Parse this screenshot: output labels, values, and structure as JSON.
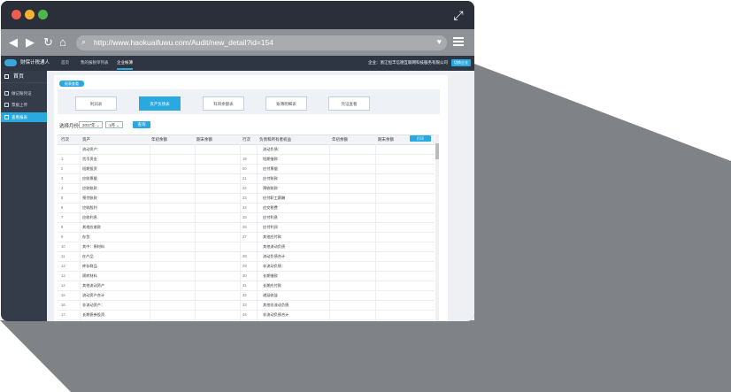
{
  "browser": {
    "url": "http://www.haokuaifuwu.com/Audit/new_detail?id=154"
  },
  "app": {
    "logo_text": "财保计税通人",
    "top_nav": [
      "首页",
      "我的报税单列表",
      "企业帐薄"
    ],
    "active_top_nav": "企业帐薄",
    "user_info": "企业：浙江恒丰信德互联网科技服务有限公司",
    "user_button": "切换企业"
  },
  "sidebar": {
    "home_label": "首页",
    "items": [
      {
        "label": "做记账凭证"
      },
      {
        "label": "票据上传"
      },
      {
        "label": "查看报表"
      }
    ],
    "active_index": 2
  },
  "content": {
    "tag": "报表查看",
    "tabs": [
      {
        "label": "利润表"
      },
      {
        "label": "资产负债表"
      },
      {
        "label": "科目余额表"
      },
      {
        "label": "账簿明细表"
      },
      {
        "label": "凭证查看"
      }
    ],
    "active_tab": 1,
    "filter_label": "选择月份",
    "year_value": "2017年",
    "month_value": "1月",
    "query_button": "查询",
    "print_button": "打印",
    "headers": [
      "行次",
      "资产",
      "年初余额",
      "期末余额",
      "行次",
      "负债和所有者权益",
      "年初余额",
      "期末余额"
    ],
    "rows": [
      {
        "n1": "",
        "left": "流动资产：",
        "n2": "",
        "right": "流动负债："
      },
      {
        "n1": "1",
        "left": "货币资金",
        "n2": "19",
        "right": "短期借款"
      },
      {
        "n1": "2",
        "left": "短期投资",
        "n2": "20",
        "right": "应付票据"
      },
      {
        "n1": "3",
        "left": "应收票据",
        "n2": "21",
        "right": "应付账款"
      },
      {
        "n1": "4",
        "left": "应收账款",
        "n2": "22",
        "right": "预收账款"
      },
      {
        "n1": "5",
        "left": "预付账款",
        "n2": "23",
        "right": "应付职工薪酬"
      },
      {
        "n1": "6",
        "left": "应收股利",
        "n2": "24",
        "right": "应交税费"
      },
      {
        "n1": "7",
        "left": "应收利息",
        "n2": "25",
        "right": "应付利息"
      },
      {
        "n1": "8",
        "left": "其他应收款",
        "n2": "26",
        "right": "应付利润"
      },
      {
        "n1": "9",
        "left": "存货",
        "n2": "27",
        "right": "其他应付款"
      },
      {
        "n1": "10",
        "left": "其中：原材料",
        "n2": "",
        "right": "其他流动负债"
      },
      {
        "n1": "11",
        "left": "在产品",
        "n2": "28",
        "right": "流动负债合计"
      },
      {
        "n1": "12",
        "left": "库存商品",
        "n2": "29",
        "right": "非流动负债："
      },
      {
        "n1": "13",
        "left": "周转材料",
        "n2": "30",
        "right": "长期借款"
      },
      {
        "n1": "14",
        "left": "其他流动资产",
        "n2": "31",
        "right": "长期应付款"
      },
      {
        "n1": "15",
        "left": "流动资产合计",
        "n2": "32",
        "right": "递延收益"
      },
      {
        "n1": "16",
        "left": "非流动资产：",
        "n2": "33",
        "right": "其他非流动负债"
      },
      {
        "n1": "17",
        "left": "长期债券投资",
        "n2": "34",
        "right": "非流动负债合计"
      }
    ]
  },
  "colors": {
    "accent": "#2aa8e0",
    "sidebar_bg": "#343b49",
    "topbar_bg": "#2e3644",
    "window_chrome": "#2b2f3a"
  }
}
